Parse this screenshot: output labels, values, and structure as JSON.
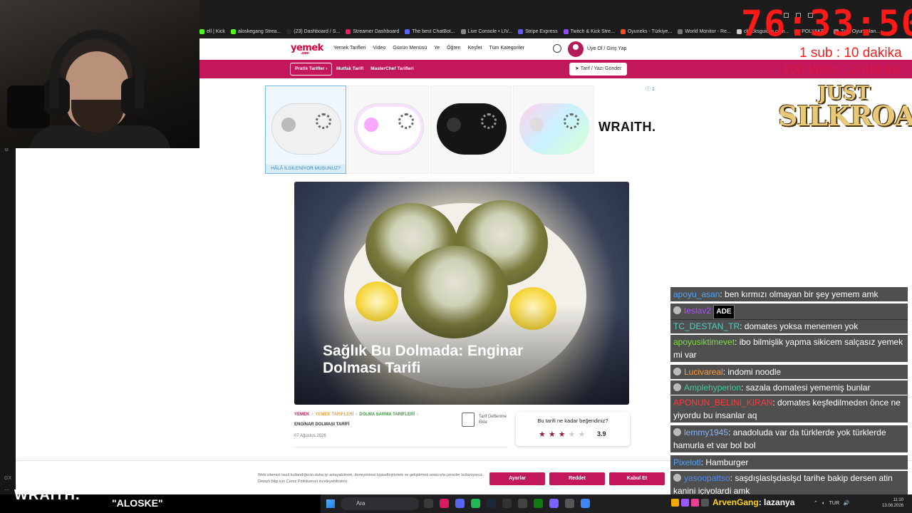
{
  "browser": {
    "bookmarks": [
      {
        "label": "ell | Kick",
        "color": "#53fc18"
      },
      {
        "label": "aloskegang Strea...",
        "color": "#53fc18"
      },
      {
        "label": "(23) Dashboard / S...",
        "color": "#2a2a2a"
      },
      {
        "label": "Streamer Dashboard",
        "color": "#e91e63"
      },
      {
        "label": "The best ChatBot...",
        "color": "#5865f2"
      },
      {
        "label": "Live Console • LIV...",
        "color": "#888888"
      },
      {
        "label": "Stripe Express",
        "color": "#635bff"
      },
      {
        "label": "Twitch & Kick Stre...",
        "color": "#9146ff"
      },
      {
        "label": "Oyuneks - Türkiye...",
        "color": "#f4511e"
      },
      {
        "label": "World Monitor - Re...",
        "color": "#777777"
      },
      {
        "label": "chucksguides.com...",
        "color": "#cccccc"
      },
      {
        "label": "POLYAKER",
        "color": "#999999"
      },
      {
        "label": "Türk Oyuncuları...",
        "color": "#999999"
      }
    ]
  },
  "site": {
    "logo": "yemek",
    "logo_sub": ".com",
    "nav": [
      "Yemek Tarifleri",
      "Video",
      "Günün Menüsü",
      "Ye",
      "Öğren",
      "Keşfet",
      "Tüm Kategoriler"
    ],
    "login": "Üye Ol  /  Giriş Yap",
    "subnav_button": "Pratik Tarifler",
    "subnav": [
      "Mutfak Tarifi",
      "MasterChef Tarifleri"
    ],
    "send_button": "Tarif / Yazı Gönder",
    "ad": {
      "caption": "HÂLÂ İLGİLENİYOR MUSUNUZ?",
      "brand": "WRAITH.",
      "info": "ⓘ 1"
    },
    "hero_title": "Sağlık Bu Dolmada: Enginar Dolması Tarifi",
    "breadcrumbs": [
      "YEMEK",
      "YEMEK TARİFLERİ",
      "DOLMA SARMA TARİFLERİ"
    ],
    "breadcrumb_last": "ENGİNAR DOLMASI TARİFİ",
    "date": "07 Ağustos 2026",
    "notebook_label": "Tarif Defterime Ekle",
    "rating_question": "Bu tarifi ne kadar beğendiniz?",
    "rating_score": "3.9",
    "rating_value": 3.9,
    "cookie_text": "Web sitemizi nasıl kullandığınızı daha iyi anlayabilmek, deneyiminizi kişiselleştirmek ve geliştirmek amacıyla çerezler kullanıyoruz. Detaylı bilgi için Çerez Politikamızı inceleyebilirsiniz.",
    "cookie_buttons": [
      "Ayarlar",
      "Reddet",
      "Kabul Et"
    ]
  },
  "overlay": {
    "timer": "76:33:50",
    "rule1": "1 sub : 10 dakika",
    "rule2": "100 kicks : 2 dakika",
    "game_logo_top": "JUST",
    "game_logo_bottom": "SILKROAD",
    "stream_watermark": "WRAITH.",
    "stream_name": "\"ALOSKE\""
  },
  "chat": [
    {
      "user": "apoyu_asan",
      "color": "#4fa3ff",
      "text": ": ben kırmızı olmayan bir şey yemem amk",
      "badge": false
    },
    {
      "user": "teslav2",
      "color": "#b14cff",
      "text": "",
      "badge": true,
      "emote": "ADE"
    },
    {
      "user": "TC_DESTAN_TR",
      "color": "#4fd1c5",
      "text": ": domates yoksa menemen yok",
      "badge": false
    },
    {
      "user": "apoyusiktimevet",
      "color": "#7ddc3f",
      "text": ": ibo bilmişlik yapma sikicem salçasız yemek mi var",
      "badge": false
    },
    {
      "user": "Lucivareal",
      "color": "#ff9a3c",
      "text": ": indomi noodle",
      "badge": true
    },
    {
      "user": "Amplehyperion",
      "color": "#3fc9a0",
      "text": ": sazala domatesi yememiş bunlar",
      "badge": true
    },
    {
      "user": "APONUN_BELINI_KIRAN",
      "color": "#ff3b3b",
      "text": ": domates keşfedilmeden önce ne yiyordu bu insanlar aq",
      "badge": false
    },
    {
      "user": "lemmy1945",
      "color": "#8ab4f8",
      "text": ": anadoluda var da türklerde yok türklerde hamurla et var bol bol",
      "badge": true
    },
    {
      "user": "Pixelotl",
      "color": "#4fa3ff",
      "text": ": Hamburger",
      "badge": false
    },
    {
      "user": "yasoopattso",
      "color": "#4f8cff",
      "text": ": saşdışlaslşdaslşd tarihe bakip dersen atin kanini içiyolardi amk",
      "badge": true
    }
  ],
  "bottom_alert": {
    "user": "ArvenGang",
    "text": ": lazanya"
  },
  "taskbar": {
    "search": "Ara",
    "tray": "TUR",
    "time": "11:10",
    "date": "13.08.2026"
  }
}
